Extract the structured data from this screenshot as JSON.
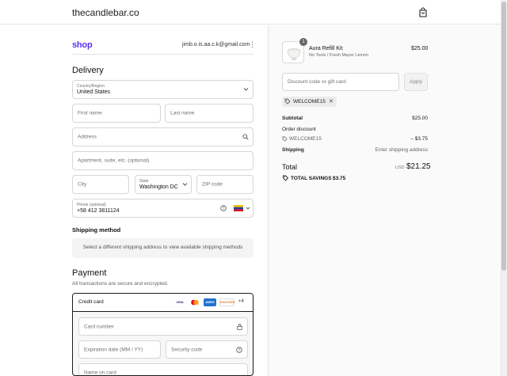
{
  "header": {
    "store_name": "thecandlebar.co",
    "cart_icon": "shopping-bag-icon"
  },
  "account": {
    "shop_logo": "shop",
    "email": "jimb.o.is.aa.c.k@gmail.com",
    "menu_icon": "⋮"
  },
  "delivery": {
    "title": "Delivery",
    "country_label": "Country/Region",
    "country_value": "United States",
    "first_name_placeholder": "First name",
    "last_name_placeholder": "Last name",
    "address_placeholder": "Address",
    "apartment_placeholder": "Apartment, suite, etc. (optional)",
    "city_placeholder": "City",
    "state_label": "State",
    "state_value": "Washington DC",
    "zip_placeholder": "ZIP code",
    "phone_label": "Phone (optional)",
    "phone_value": "+58 412 3811124"
  },
  "shipping": {
    "title": "Shipping method",
    "message": "Select a different shipping address to view available shipping methods"
  },
  "payment": {
    "title": "Payment",
    "subtitle": "All transactions are secure and encrypted.",
    "method_label": "Credit card",
    "cards": [
      "VISA",
      "MC",
      "AMEX",
      "DISCOVER"
    ],
    "more_cards": "+4",
    "card_number_placeholder": "Card number",
    "expiration_placeholder": "Expiration date (MM / YY)",
    "security_code_placeholder": "Security code",
    "name_on_card_placeholder": "Name on card"
  },
  "summary": {
    "item": {
      "quantity": "1",
      "name": "Aura Refill Kit",
      "variant": "No Tools / Fresh Mayer Lemon",
      "price": "$25.00"
    },
    "discount_placeholder": "Discount code or gift card",
    "apply_label": "Apply",
    "applied_code": "WELCOME15",
    "subtotal_label": "Subtotal",
    "subtotal_value": "$25.00",
    "order_discount_label": "Order discount",
    "discount_code": "WELCOME15",
    "discount_value": "– $3.75",
    "shipping_label": "Shipping",
    "shipping_value": "Enter shipping address",
    "total_label": "Total",
    "currency": "USD",
    "total_value": "$21.25",
    "savings_label": "TOTAL SAVINGS",
    "savings_value": "$3.75"
  },
  "colors": {
    "shop_purple": "#5a31f4",
    "border": "#d6d6d6",
    "summary_bg": "#fafafa"
  }
}
